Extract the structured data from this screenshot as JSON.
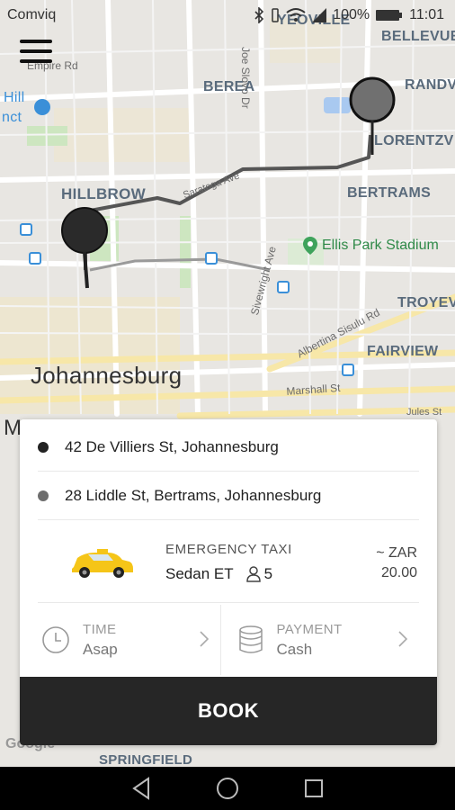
{
  "status_bar": {
    "carrier": "Comviq",
    "battery": "100%",
    "time": "11:01"
  },
  "map": {
    "area_labels": {
      "yeoville": "YEOVILLE",
      "bellevue": "BELLEVUE",
      "berea": "BEREA",
      "randburg_partial": "RANDV",
      "lorentzville_partial": "LORENTZV",
      "hillbrow": "HILLBROW",
      "bertrams": "BERTRAMS",
      "troyeville_partial": "TROYEV",
      "fairview": "FAIRVIEW",
      "johannesburg": "Johannesburg",
      "springfield": "SPRINGFIELD",
      "hill_partial": "Hill",
      "nct_partial": "nct",
      "m_partial": "M"
    },
    "street_labels": {
      "empire_rd": "Empire Rd",
      "joe_slovo": "Joe Slovo Dr",
      "saratoga": "Saratoga Ave",
      "sivewright": "Sivewright Ave",
      "albertina": "Albertina Sisulu Rd",
      "marshall": "Marshall St",
      "jules": "Jules St"
    },
    "poi": {
      "ellis_park": "Ellis Park Stadium"
    },
    "attribution": "Google"
  },
  "booking": {
    "pickup": "42 De Villiers St, Johannesburg",
    "dropoff": "28 Liddle St, Bertrams, Johannesburg",
    "ride": {
      "type": "EMERGENCY TAXI",
      "model": "Sedan ET",
      "seats": "5",
      "price_prefix": "~ ZAR",
      "price": "20.00"
    },
    "time": {
      "label": "TIME",
      "value": "Asap"
    },
    "payment": {
      "label": "PAYMENT",
      "value": "Cash"
    },
    "book_label": "BOOK"
  },
  "colors": {
    "pickup_dot": "#222222",
    "dropoff_dot": "#6e6e6e",
    "book_bg": "#262626",
    "taxi": "#f5c518"
  }
}
